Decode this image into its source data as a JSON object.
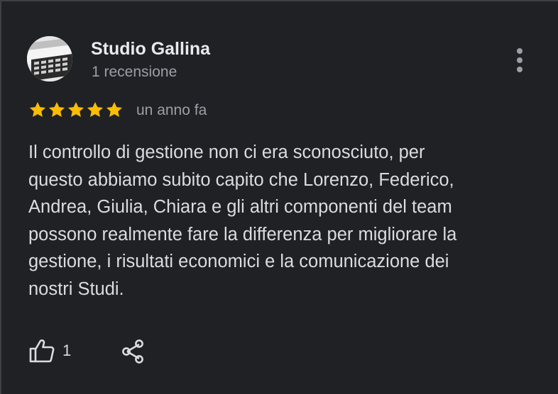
{
  "review": {
    "reviewer_name": "Studio Gallina",
    "review_count": "1 recensione",
    "rating": 5,
    "rating_max": 5,
    "time_ago": "un anno fa",
    "text_lines": [
      "Il controllo di gestione non ci era sconosciuto, per",
      "questo abbiamo subito capito che Lorenzo, Federico,",
      "Andrea, Giulia, Chiara e gli altri componenti del team",
      "possono realmente fare la differenza per migliorare la",
      "gestione, i risultati economici e la comunicazione dei",
      "nostri Studi."
    ],
    "like_count": "1"
  },
  "icons": {
    "menu": "more-vert-icon",
    "like": "thumb-up-icon",
    "share": "share-icon",
    "avatar": "calculator-photo"
  },
  "colors": {
    "background": "#202124",
    "star": "#fbbc04",
    "text": "#dadce0",
    "secondary_text": "#9aa0a6"
  }
}
